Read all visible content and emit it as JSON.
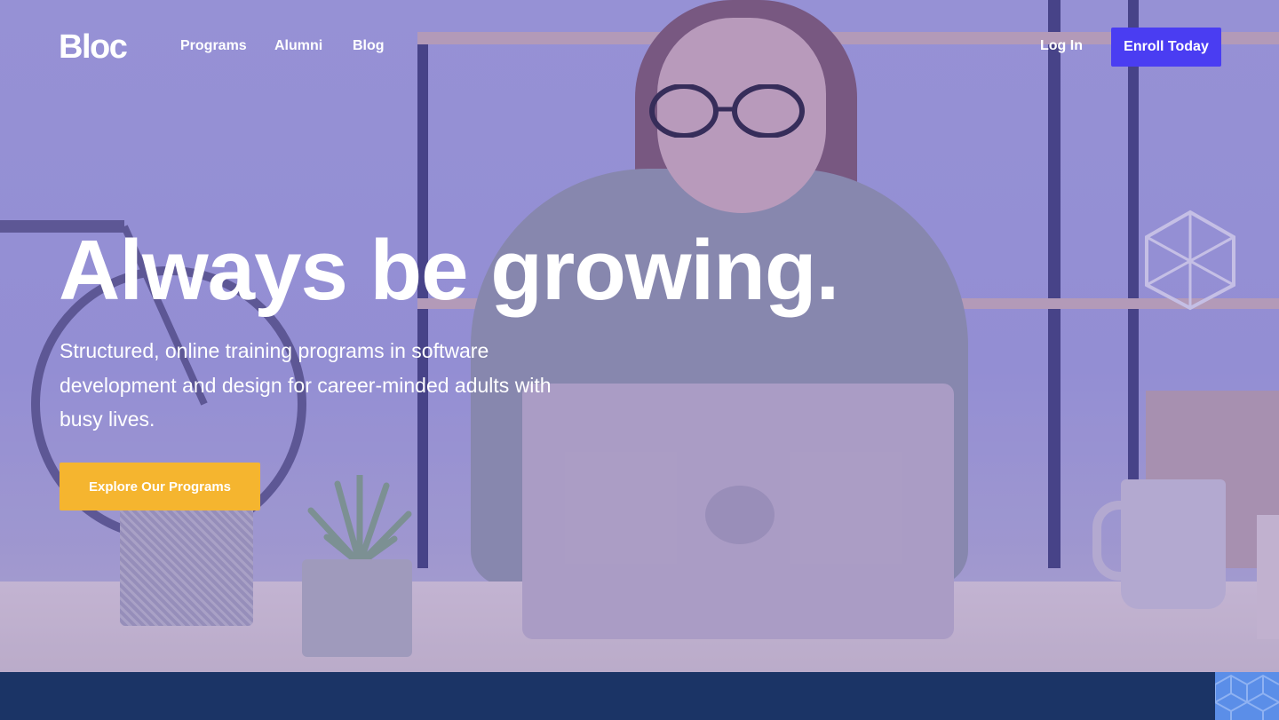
{
  "brand": {
    "logo_text": "Bloc"
  },
  "nav": {
    "links": [
      "Programs",
      "Alumni",
      "Blog"
    ],
    "login_label": "Log In",
    "enroll_label": "Enroll Today"
  },
  "hero": {
    "headline": "Always be growing.",
    "subtext": "Structured, online training programs in software development and design for career-minded adults with busy lives.",
    "cta_label": "Explore Our Programs"
  },
  "colors": {
    "enroll_button": "#4a3df2",
    "cta_button": "#f5b52f",
    "hero_overlay": "#9f9bd6",
    "footer_band": "#1b3466"
  }
}
